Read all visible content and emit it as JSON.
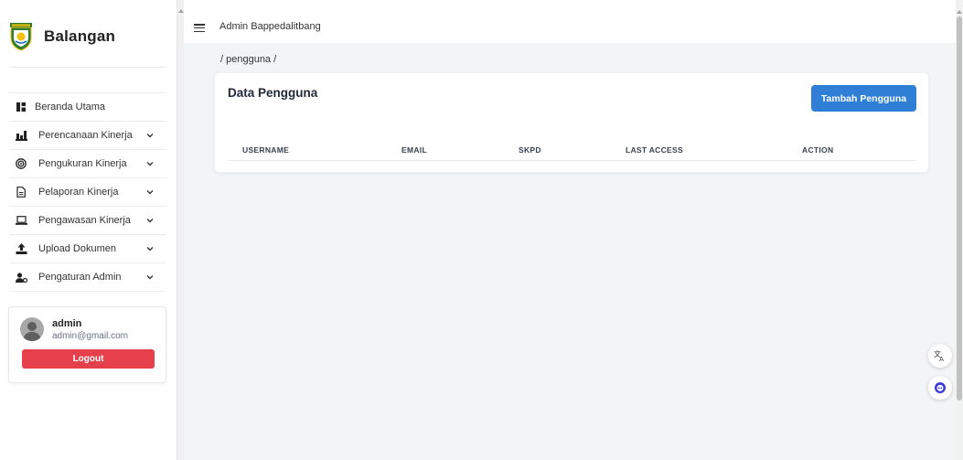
{
  "sidebar": {
    "brand": "Balangan",
    "menu": [
      {
        "label": "Beranda Utama",
        "icon": "dashboard-icon",
        "has_submenu": false
      },
      {
        "label": "Perencanaan Kinerja",
        "icon": "chart-icon",
        "has_submenu": true
      },
      {
        "label": "Pengukuran Kinerja",
        "icon": "target-icon",
        "has_submenu": true
      },
      {
        "label": "Pelaporan Kinerja",
        "icon": "document-icon",
        "has_submenu": true
      },
      {
        "label": "Pengawasan Kinerja",
        "icon": "laptop-icon",
        "has_submenu": true
      },
      {
        "label": "Upload Dokumen",
        "icon": "upload-icon",
        "has_submenu": true
      },
      {
        "label": "Pengaturan Admin",
        "icon": "user-cog-icon",
        "has_submenu": true
      }
    ],
    "user": {
      "name": "admin",
      "email": "admin@gmail.com",
      "logout_label": "Logout"
    }
  },
  "topbar": {
    "title": "Admin Bappedalitbang"
  },
  "breadcrumb": "/ pengguna /",
  "card": {
    "title": "Data Pengguna",
    "add_button": "Tambah Pengguna",
    "columns": [
      "USERNAME",
      "EMAIL",
      "SKPD",
      "LAST ACCESS",
      "ACTION"
    ]
  },
  "floating": {
    "translate_icon": "translate-icon",
    "assistant_icon": "assistant-icon"
  },
  "colors": {
    "primary": "#2f7fd6",
    "danger": "#e5404c",
    "background": "#f3f4f6"
  }
}
